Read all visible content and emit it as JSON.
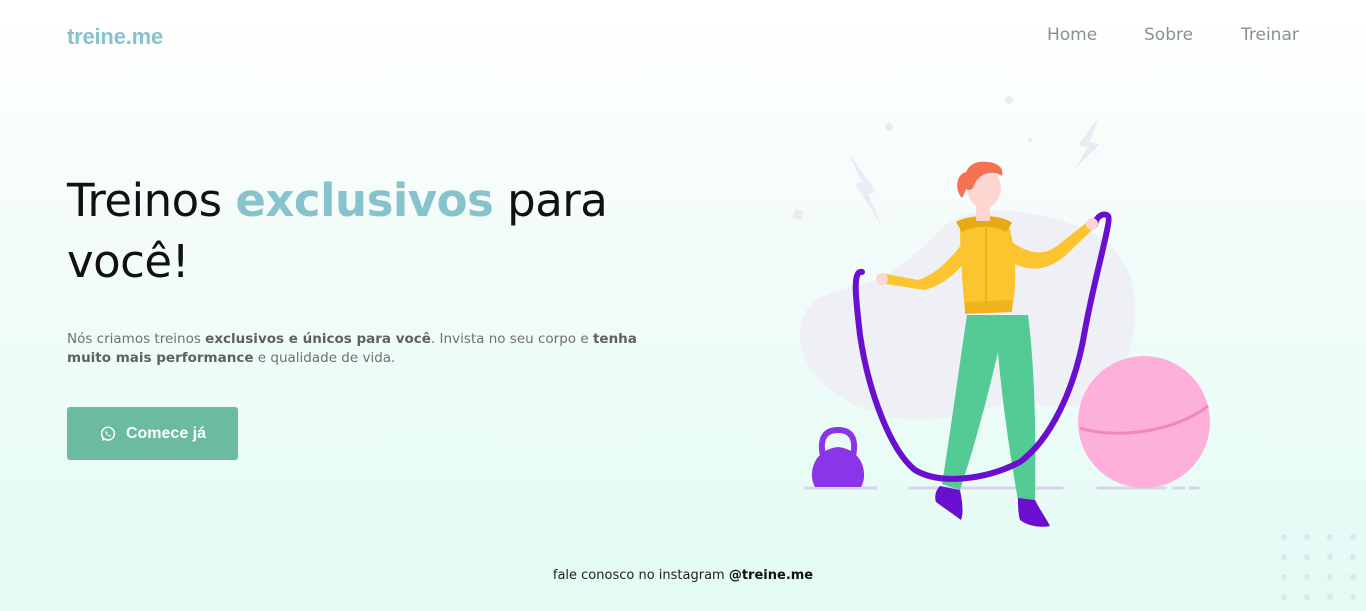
{
  "brand": {
    "logo": "treine.me",
    "color": "#86c3cc"
  },
  "nav": {
    "items": [
      "Home",
      "Sobre",
      "Treinar"
    ]
  },
  "hero": {
    "title_before": "Treinos ",
    "title_highlight": "exclusivos",
    "title_after": " para você!",
    "desc_1": "Nós criamos treinos ",
    "desc_2_bold": "exclusivos e únicos para você",
    "desc_3": ". Invista no seu corpo e ",
    "desc_4_bold": "tenha muito mais performance",
    "desc_5": " e qualidade de vida.",
    "cta_label": "Comece já",
    "cta_icon": "whatsapp-icon",
    "cta_color": "#6bbc9e"
  },
  "illustration": {
    "name": "woman-jumping-rope-illustration"
  },
  "footer": {
    "text": "fale conosco no instagram ",
    "handle": "@treine.me"
  }
}
